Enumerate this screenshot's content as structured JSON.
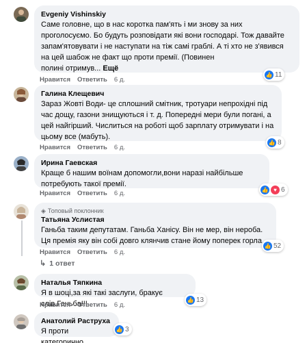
{
  "actions": {
    "like": "Нравится",
    "reply": "Ответить"
  },
  "comments": [
    {
      "author": "Evgeniy Vishinskiy",
      "text": "Саме головне, що в нас коротка пам'ять і ми знову за них проголосуємо. Бо будуть розповідати які вони господарі. Тож давайте запам'ятовувати і не наступати на тіж самі граблі. А ті хто не з'явився на цей шабож не факт що проти премії. (Повинен",
      "text_tail": "полині отримув...",
      "more": "Ещё",
      "time": "6 д.",
      "reaction_count": "11",
      "reactions": [
        "like"
      ]
    },
    {
      "author": "Галина Клещевич",
      "text": "Зараз Жовті Води- це сплошний смітник, тротуари непрохідні під час дощу, газони знищуються і т. д. Попередні мери були погані, а цей найгірший. Числиться на роботі щоб зарплату отримувати і на цьому все (мабуть).",
      "time": "6 д.",
      "reaction_count": "8",
      "reactions": [
        "like"
      ]
    },
    {
      "author": "Ирина Гаевская",
      "text": "Краще б нашим воїнам допомогли,вони наразі найбільше потребують такої премії.",
      "time": "6 д.",
      "reaction_count": "6",
      "reactions": [
        "like",
        "love"
      ]
    },
    {
      "badge": "Топовый поклонник",
      "author": "Татьяна Услистая",
      "text": "Ганьба таким депутатам. Ганьба Ханісу. Він не мер, він нероба. Ця премія яку він собі довго клянчив стане йому поперек горла.",
      "time": "6 д.",
      "reaction_count": "52",
      "reactions": [
        "like"
      ],
      "replies": "1 ответ"
    },
    {
      "author": "Наталья Тяпкина",
      "text": "Я в шоці,за які такі заслуги, бракує слів.Ганьба!!!",
      "time": "6 д.",
      "reaction_count": "13",
      "reactions": [
        "like"
      ]
    },
    {
      "author": "Анатолий Раструха",
      "text": "Я проти категорично",
      "reaction_count": "3",
      "reactions": [
        "like"
      ]
    }
  ]
}
